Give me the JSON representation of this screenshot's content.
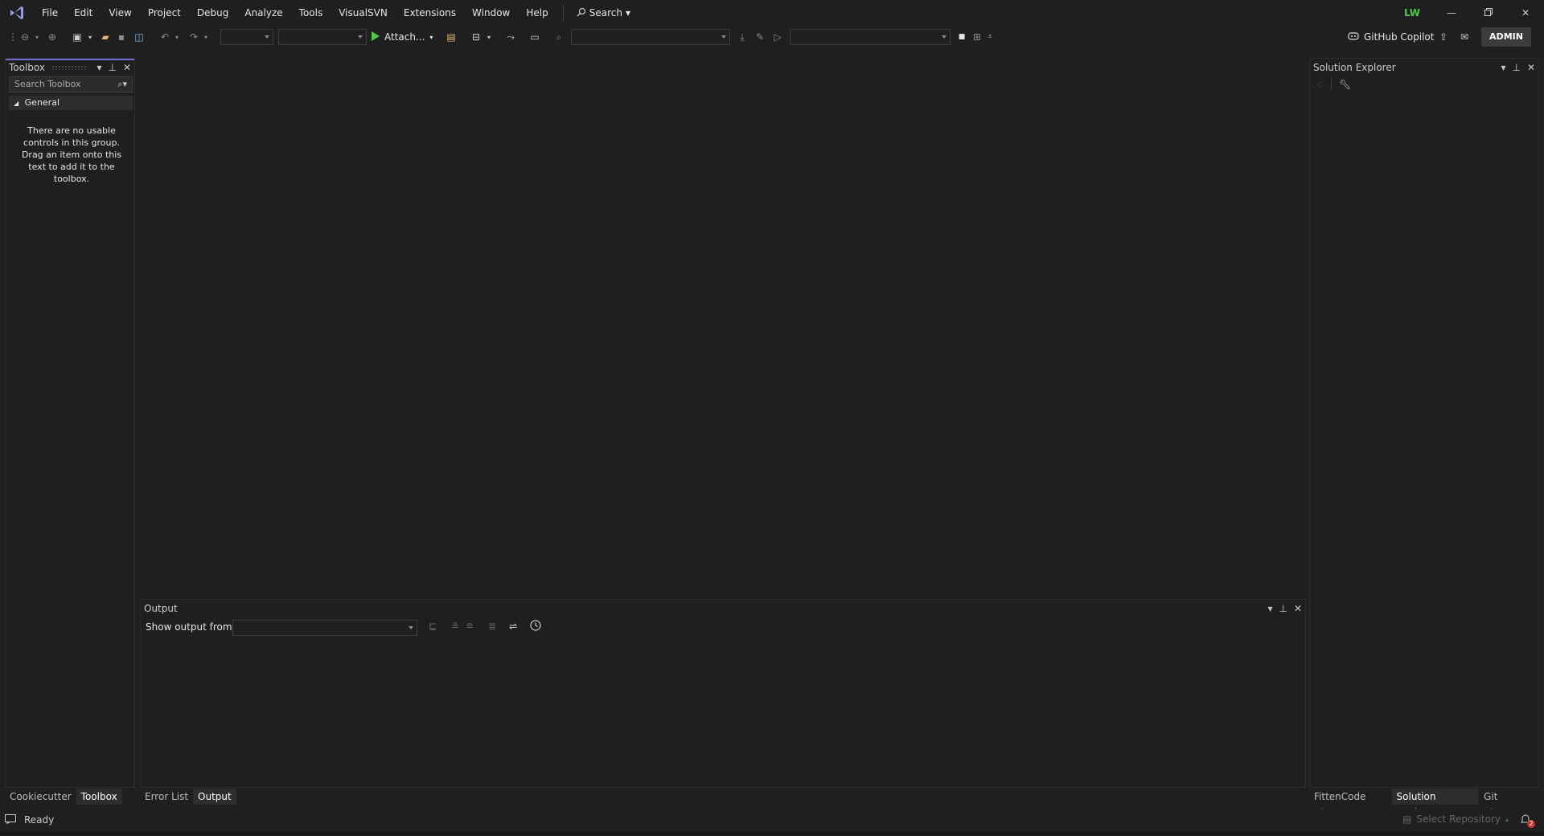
{
  "menu": {
    "items": [
      "File",
      "Edit",
      "View",
      "Project",
      "Debug",
      "Analyze",
      "Tools",
      "VisualSVN",
      "Extensions",
      "Window",
      "Help"
    ],
    "search_label": "Search"
  },
  "account": {
    "initials": "LW"
  },
  "toolbar": {
    "attach_label": "Attach...",
    "copilot_label": "GitHub Copilot",
    "admin_label": "ADMIN"
  },
  "toolbox": {
    "title": "Toolbox",
    "search_placeholder": "Search Toolbox",
    "group_label": "General",
    "empty_message": "There are no usable controls in this group. Drag an item onto this text to add it to the toolbox."
  },
  "solution_explorer": {
    "title": "Solution Explorer"
  },
  "output": {
    "title": "Output",
    "show_output_label": "Show output from:"
  },
  "tabs": {
    "left": [
      "Cookiecutter",
      "Toolbox"
    ],
    "left_active": "Toolbox",
    "center": [
      "Error List",
      "Output"
    ],
    "center_active": "Output",
    "right": [
      "FittenCode Chat",
      "Solution Explorer",
      "Git Changes"
    ],
    "right_active": "Solution Explorer"
  },
  "status": {
    "ready": "Ready",
    "select_repository": "Select Repository",
    "notification_count": "2"
  },
  "colors": {
    "accent": "#6d6dd4",
    "play_green": "#4ec94e",
    "avatar_green": "#4ec94e"
  }
}
